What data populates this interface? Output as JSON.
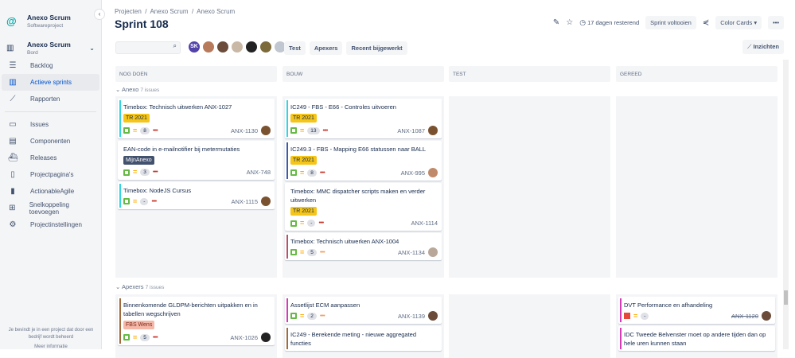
{
  "sidebar": {
    "project_name": "Anexo Scrum",
    "project_type": "Softwareproject",
    "board_name": "Anexo Scrum",
    "board_type": "Bord",
    "items": [
      {
        "label": "Backlog",
        "icon": "backlog-icon"
      },
      {
        "label": "Actieve sprints",
        "icon": "board-icon",
        "active": true
      },
      {
        "label": "Rapporten",
        "icon": "chart-icon"
      }
    ],
    "items2": [
      {
        "label": "Issues"
      },
      {
        "label": "Componenten"
      },
      {
        "label": "Releases"
      },
      {
        "label": "Projectpagina's"
      },
      {
        "label": "ActionableAgile"
      },
      {
        "label": "Snelkoppeling toevoegen"
      },
      {
        "label": "Projectinstellingen"
      }
    ],
    "footer": "Je bevindt je in een project dat door een bedrijf wordt beheerd",
    "footer_link": "Meer informatie"
  },
  "header": {
    "breadcrumb": [
      "Projecten",
      "Anexo Scrum",
      "Anexo Scrum"
    ],
    "title": "Sprint 108",
    "remaining": "17 dagen resterend",
    "complete_sprint": "Sprint voltooien",
    "color_cards": "Color Cards",
    "more": "•••",
    "insights": "Inzichten"
  },
  "filters": {
    "avatar_initials": "SK",
    "quick": [
      "Test",
      "Apexers",
      "Recent bijgewerkt"
    ]
  },
  "columns": [
    "NOG DOEN",
    "BOUW",
    "TEST",
    "GEREED"
  ],
  "lanes": [
    {
      "name": "Anexo",
      "count": "7 issues"
    },
    {
      "name": "Apexers",
      "count": "7 issues"
    }
  ],
  "cards": {
    "a_todo": [
      {
        "title": "Timebox: Technisch uitwerken ANX-1027",
        "label": "TR 2021",
        "points": "8",
        "key": "ANX-1130"
      },
      {
        "title": "EAN-code in e-mailnotifier bij metermutaties",
        "label": "MijnAnexo",
        "points": "3",
        "key": "ANX-748"
      },
      {
        "title": "Timebox: NodeJS Cursus",
        "points": "-",
        "key": "ANX-1115"
      }
    ],
    "a_bouw": [
      {
        "title": "IC249 - FBS - E66 - Controles uitvoeren",
        "label": "TR 2021",
        "points": "13",
        "key": "ANX-1087"
      },
      {
        "title": "IC249.3 - FBS - Mapping E66 statussen naar BALL",
        "label": "TR 2021",
        "points": "8",
        "key": "ANX-995"
      },
      {
        "title": "Timebox: MMC dispatcher scripts maken en verder uitwerken",
        "label": "TR 2021",
        "points": "-",
        "key": "ANX-1114"
      },
      {
        "title": "Timebox: Technisch uitwerken ANX-1004",
        "points": "5",
        "key": "ANX-1134"
      }
    ],
    "b_todo": [
      {
        "title": "Binnenkomende GLDPM-berichten uitpakken en in tabellen wegschrijven",
        "label": "FBS Wens",
        "points": "5",
        "key": "ANX-1026"
      }
    ],
    "b_bouw": [
      {
        "title": "Assetlijst ECM aanpassen",
        "points": "2",
        "key": "ANX-1139"
      },
      {
        "title": "IC249 - Berekende meting - nieuwe aggregated functies"
      }
    ],
    "b_gereed": [
      {
        "title": "DVT Performance en afhandeling",
        "points": "-",
        "key": "ANX-1120"
      },
      {
        "title": "IDC Tweede Belvenster moet op andere tijden dan op hele uren kunnen staan"
      }
    ]
  },
  "colors": {
    "tr": "#f5c518",
    "mijn": "#42526e",
    "fbs": "#f5b7a8"
  }
}
